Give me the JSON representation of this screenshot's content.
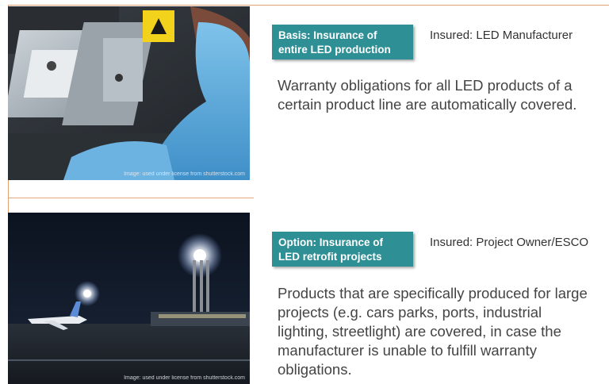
{
  "section_basis": {
    "tag_lines": [
      "Basis: Insurance of",
      "entire LED production"
    ],
    "insured": "Insured: LED Manufacturer",
    "body_lines": [
      "Warranty obligations for all LED products of a",
      "certain product line are automatically covered."
    ],
    "photo_credit": "Image: used under license from shutterstock.com"
  },
  "section_option": {
    "tag_lines": [
      "Option: Insurance of",
      "LED retrofit projects"
    ],
    "insured": "Insured: Project Owner/ESCO",
    "body_lines": [
      "Products that are specifically produced for large",
      "projects (e.g. cars parks, ports, industrial",
      "lighting, streetlight) are covered, in case the",
      "manufacturer is unable to fulfill warranty",
      "obligations."
    ],
    "photo_credit": "Image: used under license from shutterstock.com"
  },
  "colors": {
    "tag_background": "#2e8f95",
    "frame_accent": "#e5a070"
  }
}
